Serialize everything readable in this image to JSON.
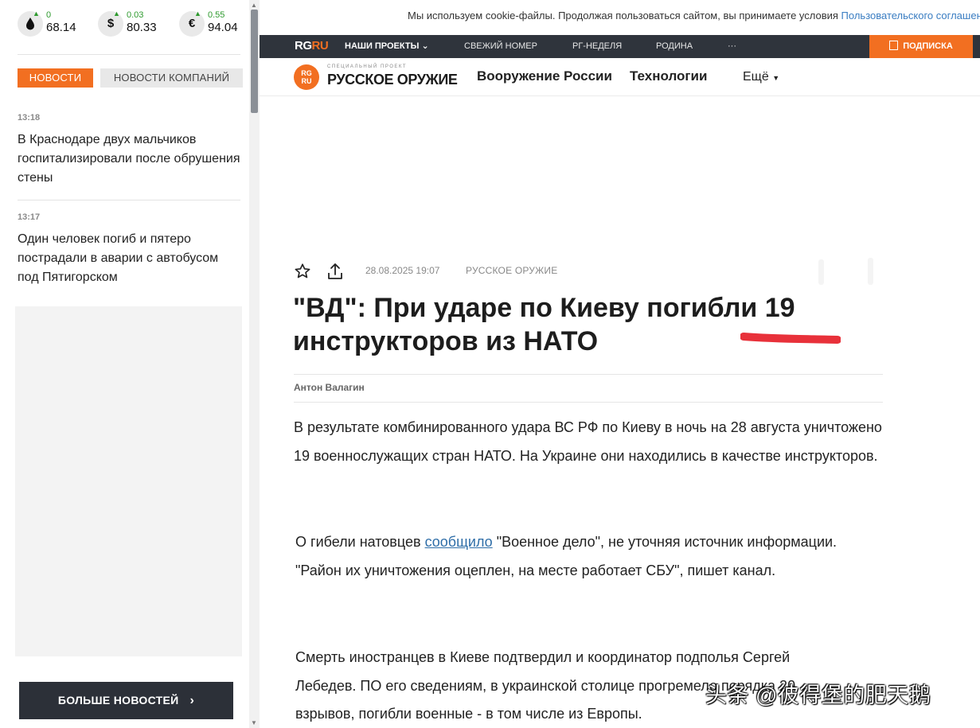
{
  "rates": [
    {
      "symbol": "💧",
      "icon": "oil-drop-icon",
      "delta": "0",
      "value": "68.14"
    },
    {
      "symbol": "$",
      "icon": "dollar-icon",
      "delta": "0.03",
      "value": "80.33"
    },
    {
      "symbol": "€",
      "icon": "euro-icon",
      "delta": "0.55",
      "value": "94.04"
    }
  ],
  "sidebar": {
    "tabs": [
      "НОВОСТИ",
      "НОВОСТИ КОМПАНИЙ"
    ],
    "news": [
      {
        "time": "13:18",
        "title": "В Краснодаре двух мальчиков госпитализировали после обрушения стены"
      },
      {
        "time": "13:17",
        "title": "Один человек погиб и пятеро пострадали в аварии с автобусом под Пятигорском"
      }
    ],
    "more_button": "БОЛЬШЕ НОВОСТЕЙ"
  },
  "cookie": {
    "text": "Мы используем cookie-файлы. Продолжая пользоваться сайтом, вы принимаете условия ",
    "link": "Пользовательского соглашения"
  },
  "top_nav": {
    "logo_left": "RG",
    "logo_right": "RU",
    "items": [
      "НАШИ ПРОЕКТЫ",
      "СВЕЖИЙ НОМЕР",
      "РГ-НЕДЕЛЯ",
      "РОДИНА",
      "···"
    ],
    "subscribe": "ПОДПИСКА"
  },
  "project_nav": {
    "badge_top": "RG",
    "badge_bottom": "RU",
    "subtitle": "специальный проект",
    "title": "РУССКОЕ ОРУЖИЕ",
    "links": [
      "Вооружение России",
      "Технологии"
    ],
    "more": "Ещё"
  },
  "article": {
    "date": "28.08.2025 19:07",
    "rubric": "РУССКОЕ ОРУЖИЕ",
    "headline": "\"ВД\": При ударе по Киеву погибли 19 инструкторов из НАТО",
    "author": "Антон Валагин",
    "p1": "В результате комбинированного удара ВС РФ по Киеву в ночь на 28 августа уничтожено 19 военнослужащих стран НАТО. На Украине они находились в качестве инструкторов.",
    "p2_before": "О гибели натовцев ",
    "p2_link": "сообщило",
    "p2_after": " \"Военное дело\", не уточняя источник информации. \"Район их уничтожения оцеплен, на месте работает СБУ\", пишет канал.",
    "p3": "Смерть иностранцев в Киеве подтвердил и координатор подполья Сергей Лебедев. ПО его сведениям, в украинской столице прогремело порядка 20 взрывов, погибли военные - в том числе из Европы."
  },
  "watermark": "头条 @彼得堡的肥天鹅",
  "colors": {
    "accent": "#f26f21",
    "dark_nav": "#2f343c",
    "up_green": "#2e9a2e",
    "link": "#2f6ea8",
    "highlight_red": "#e8313a"
  }
}
